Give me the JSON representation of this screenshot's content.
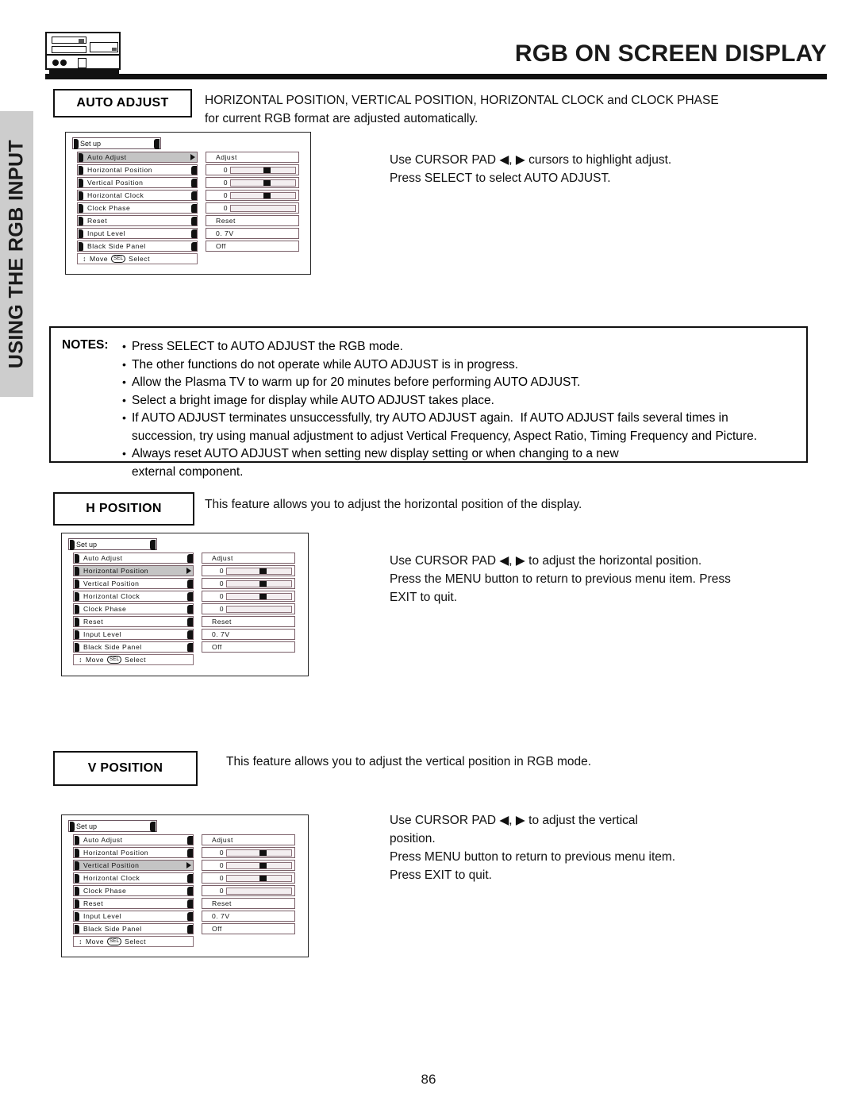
{
  "header": {
    "title": "RGB ON SCREEN DISPLAY",
    "device_icon": "av-component-icon"
  },
  "side_tab": {
    "label": "USING THE RGB INPUT"
  },
  "page_number": "86",
  "sections": {
    "auto_adjust": {
      "label": "AUTO ADJUST",
      "description": "HORIZONTAL POSITION, VERTICAL POSITION, HORIZONTAL CLOCK and CLOCK PHASE\nfor current RGB format are adjusted automatically.",
      "steps": "Use CURSOR PAD ◀, ▶ cursors to highlight adjust.\nPress SELECT to select AUTO ADJUST."
    },
    "h_position": {
      "label": "H POSITION",
      "description": "This feature allows you to adjust the horizontal position of the display.",
      "steps": "Use CURSOR PAD ◀, ▶ to adjust the horizontal position.\nPress the MENU button to return to previous menu item. Press\nEXIT to quit."
    },
    "v_position": {
      "label": "V POSITION",
      "description": "This feature allows you to adjust the vertical position in RGB mode.",
      "steps": "Use CURSOR PAD ◀, ▶ to adjust the vertical\nposition.\nPress MENU button to return to previous menu item.\nPress EXIT to quit."
    }
  },
  "notes": {
    "label": "NOTES:",
    "items": [
      "Press SELECT to AUTO ADJUST the RGB mode.",
      "The other functions do not operate while AUTO ADJUST is in progress.",
      "Allow the Plasma TV to warm up for 20 minutes before performing AUTO ADJUST.",
      "Select a bright image for display while AUTO ADJUST takes place.",
      "If AUTO ADJUST terminates unsuccessfully, try AUTO ADJUST again.  If AUTO ADJUST fails several times in\nsuccession, try using manual adjustment to adjust Vertical Frequency, Aspect Ratio, Timing Frequency and Picture.",
      "Always reset AUTO ADJUST when setting new display setting or when changing to a new\nexternal component."
    ]
  },
  "osd_menus": [
    {
      "title": "Set up",
      "selected": "Auto Adjust",
      "hint": {
        "move": "Move",
        "key": "SEL",
        "select": "Select"
      },
      "rows": [
        {
          "name": "Auto Adjust",
          "value_type": "text",
          "value": "Adjust"
        },
        {
          "name": "Horizontal Position",
          "value_type": "slider",
          "value": "0",
          "fill": 55
        },
        {
          "name": "Vertical Position",
          "value_type": "slider",
          "value": "0",
          "fill": 55
        },
        {
          "name": "Horizontal Clock",
          "value_type": "slider",
          "value": "0",
          "fill": 55
        },
        {
          "name": "Clock Phase",
          "value_type": "slider",
          "value": "0",
          "fill": -1
        },
        {
          "name": "Reset",
          "value_type": "text",
          "value": "Reset"
        },
        {
          "name": "Input Level",
          "value_type": "text",
          "value": "0. 7V"
        },
        {
          "name": "Black Side Panel",
          "value_type": "text",
          "value": "Off"
        }
      ]
    },
    {
      "title": "Set up",
      "selected": "Horizontal Position",
      "hint": {
        "move": "Move",
        "key": "SEL",
        "select": "Select"
      },
      "rows": [
        {
          "name": "Auto Adjust",
          "value_type": "text",
          "value": "Adjust"
        },
        {
          "name": "Horizontal Position",
          "value_type": "slider",
          "value": "0",
          "fill": 55
        },
        {
          "name": "Vertical Position",
          "value_type": "slider",
          "value": "0",
          "fill": 55
        },
        {
          "name": "Horizontal Clock",
          "value_type": "slider",
          "value": "0",
          "fill": 55
        },
        {
          "name": "Clock Phase",
          "value_type": "slider",
          "value": "0",
          "fill": -1
        },
        {
          "name": "Reset",
          "value_type": "text",
          "value": "Reset"
        },
        {
          "name": "Input Level",
          "value_type": "text",
          "value": "0. 7V"
        },
        {
          "name": "Black Side Panel",
          "value_type": "text",
          "value": "Off"
        }
      ]
    },
    {
      "title": "Set up",
      "selected": "Vertical Position",
      "hint": {
        "move": "Move",
        "key": "SEL",
        "select": "Select"
      },
      "rows": [
        {
          "name": "Auto Adjust",
          "value_type": "text",
          "value": "Adjust"
        },
        {
          "name": "Horizontal Position",
          "value_type": "slider",
          "value": "0",
          "fill": 55
        },
        {
          "name": "Vertical Position",
          "value_type": "slider",
          "value": "0",
          "fill": 55
        },
        {
          "name": "Horizontal Clock",
          "value_type": "slider",
          "value": "0",
          "fill": 55
        },
        {
          "name": "Clock Phase",
          "value_type": "slider",
          "value": "0",
          "fill": -1
        },
        {
          "name": "Reset",
          "value_type": "text",
          "value": "Reset"
        },
        {
          "name": "Input Level",
          "value_type": "text",
          "value": "0. 7V"
        },
        {
          "name": "Black Side Panel",
          "value_type": "text",
          "value": "Off"
        }
      ]
    }
  ]
}
